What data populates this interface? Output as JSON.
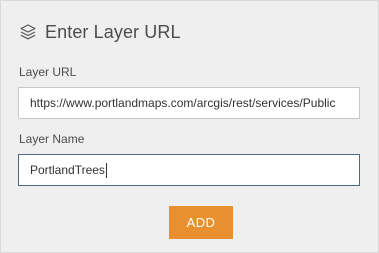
{
  "header": {
    "title": "Enter Layer URL",
    "icon": "layers-icon"
  },
  "form": {
    "url_label": "Layer URL",
    "url_value": "https://www.portlandmaps.com/arcgis/rest/services/Public",
    "name_label": "Layer Name",
    "name_value": "PortlandTrees",
    "add_label": "ADD"
  },
  "colors": {
    "panel_bg": "#efefef",
    "accent_button": "#e8902f",
    "focus_border": "#4c6b8a"
  }
}
